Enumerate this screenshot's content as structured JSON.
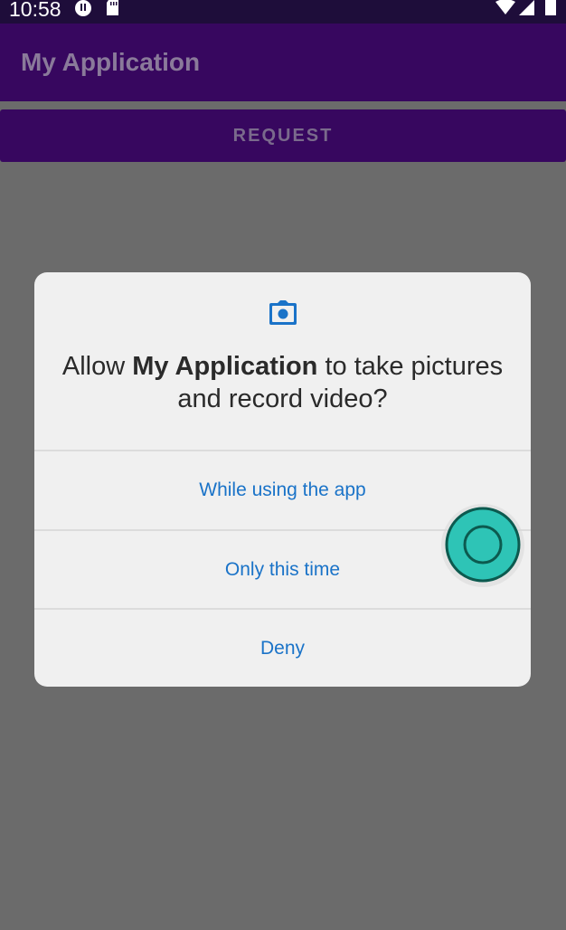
{
  "status_bar": {
    "time": "10:58",
    "icons": [
      "pause-circle-icon",
      "sd-card-icon",
      "wifi-icon",
      "signal-icon",
      "battery-icon"
    ]
  },
  "app_bar": {
    "title": "My Application"
  },
  "main": {
    "request_button_label": "REQUEST"
  },
  "dialog": {
    "icon": "camera-icon",
    "message_prefix": "Allow ",
    "app_name": "My Application",
    "message_suffix": " to take pictures and record video?",
    "options": [
      {
        "label": "While using the app"
      },
      {
        "label": "Only this time"
      },
      {
        "label": "Deny"
      }
    ]
  },
  "colors": {
    "status_bar": "#1e0d3a",
    "app_bar": "#37075f",
    "scrim_background": "#6b6b6b",
    "dialog_background": "#f0f0f0",
    "option_text": "#1a73c8",
    "touch_indicator": "#2ec4b6"
  }
}
